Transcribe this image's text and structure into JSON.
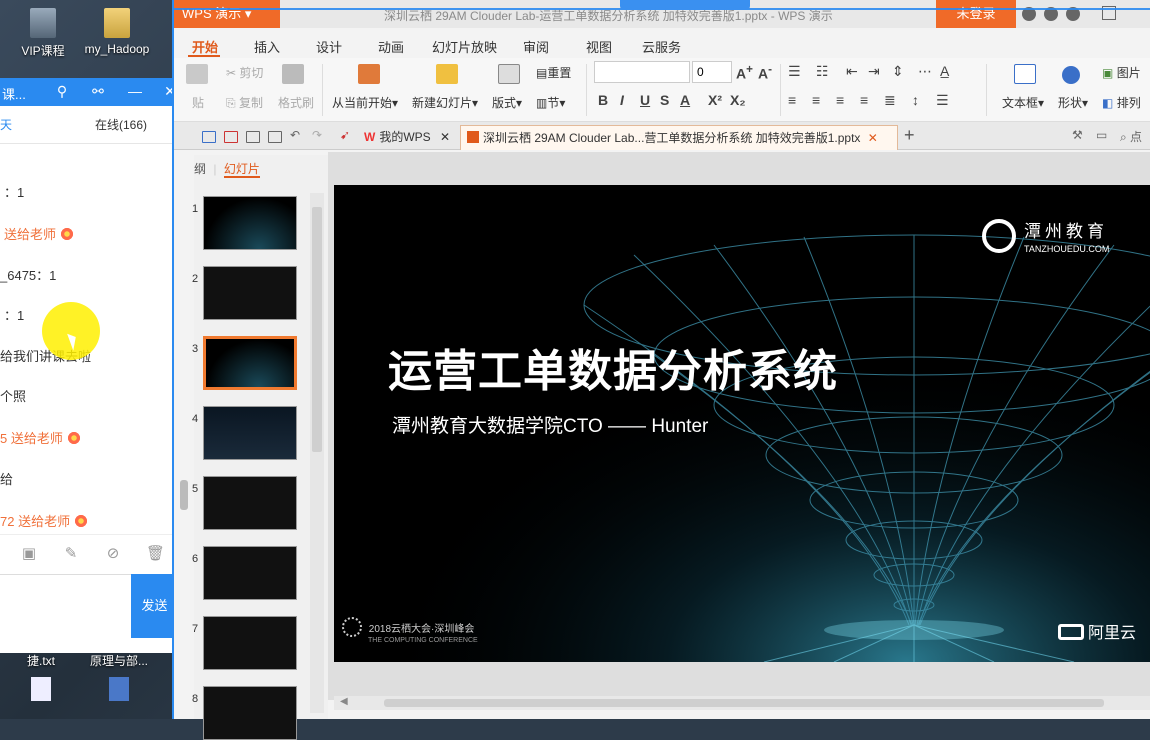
{
  "desktop": {
    "icons": [
      {
        "label": "VIP课程"
      },
      {
        "label": "my_Hadoop"
      }
    ],
    "bottom_files": [
      {
        "label": "捷.txt"
      },
      {
        "label": "原理与部..."
      }
    ]
  },
  "chat": {
    "title": "课...",
    "tabs": [
      "天",
      "在线(166)"
    ],
    "messages": [
      {
        "text": "：1",
        "type": "normal"
      },
      {
        "text": "送给老师",
        "type": "gift"
      },
      {
        "text": "_6475：1",
        "type": "normal"
      },
      {
        "text": "：1",
        "type": "normal"
      },
      {
        "text": "给我们讲课去啦",
        "type": "normal"
      },
      {
        "text": "个照",
        "type": "normal"
      },
      {
        "text": "5 送给老师",
        "type": "gift"
      },
      {
        "text": "给",
        "type": "normal"
      },
      {
        "text": "72 送给老师",
        "type": "gift"
      }
    ],
    "send_label": "发送"
  },
  "wps": {
    "app_label": "WPS 演示",
    "doc_title": "深圳云栖 29AM Clouder Lab-运营工单数据分析系统 加特效完善版1.pptx - WPS 演示",
    "login_label": "未登录",
    "menu": [
      "开始",
      "插入",
      "设计",
      "动画",
      "幻灯片放映",
      "审阅",
      "视图",
      "云服务"
    ],
    "ribbon": {
      "cut": "剪切",
      "paste": "贴",
      "copy": "复制",
      "format_painter": "格式刷",
      "from_current": "从当前开始",
      "new_slide": "新建幻灯片",
      "layout": "版式",
      "reset": "重置",
      "section": "节",
      "font_size": "0",
      "textbox": "文本框",
      "shapes": "形状",
      "picture": "图片",
      "arrange": "排列"
    },
    "tabs": {
      "mywps": "我的WPS",
      "doc": "深圳云栖 29AM Clouder Lab...营工单数据分析系统 加特效完善版1.pptx"
    },
    "pane": {
      "outline": "纲",
      "slides": "幻灯片",
      "numbers": [
        "1",
        "2",
        "3",
        "4",
        "5",
        "6",
        "7",
        "8"
      ]
    },
    "slide": {
      "title": "运营工单数据分析系统",
      "subtitle": "潭州教育大数据学院CTO  —— Hunter",
      "logo_cn": "潭州教育",
      "logo_en": "TANZHOUEDU.COM",
      "conference": "2018云栖大会·深圳峰会",
      "conference_en": "THE COMPUTING CONFERENCE",
      "partner": "阿里云"
    }
  }
}
